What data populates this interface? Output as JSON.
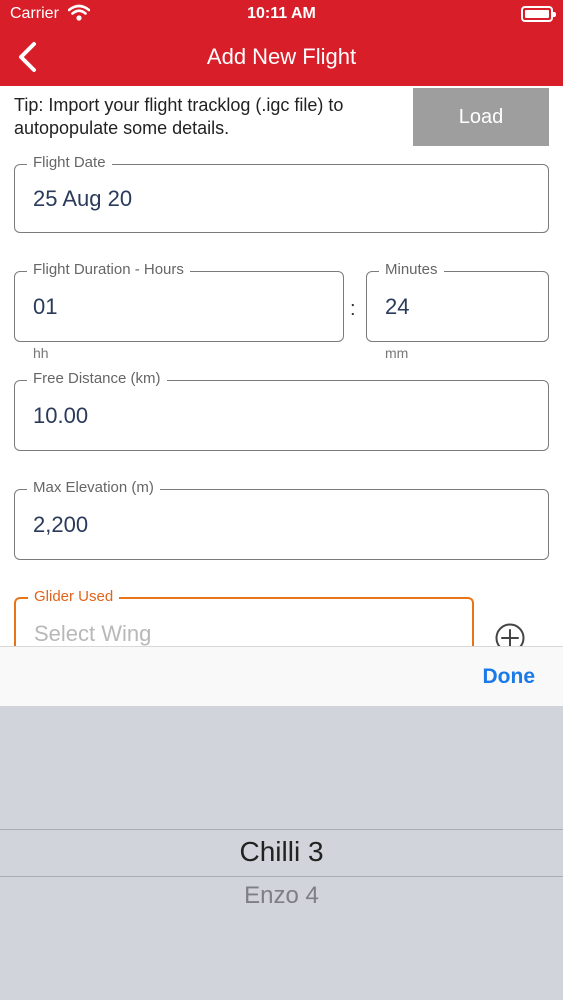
{
  "status": {
    "carrier": "Carrier",
    "time": "10:11 AM"
  },
  "nav": {
    "title": "Add New Flight"
  },
  "tip": {
    "text": "Tip: Import your flight tracklog (.igc file) to autopopulate some details.",
    "load_label": "Load"
  },
  "form": {
    "flight_date": {
      "label": "Flight Date",
      "value": "25 Aug 20"
    },
    "duration_hours": {
      "label": "Flight Duration - Hours",
      "value": "01",
      "helper": "hh"
    },
    "duration_minutes": {
      "label": "Minutes",
      "value": "24",
      "helper": "mm"
    },
    "separator": ":",
    "free_distance": {
      "label": "Free Distance (km)",
      "value": "10.00"
    },
    "max_elevation": {
      "label": "Max Elevation (m)",
      "value": "2,200"
    },
    "glider": {
      "label": "Glider Used",
      "placeholder": "Select Wing"
    }
  },
  "toolbar": {
    "done_label": "Done"
  },
  "picker": {
    "options": [
      "Chilli 3",
      "Enzo 4"
    ]
  },
  "colors": {
    "brand": "#d81e29",
    "focus": "#e8751a",
    "link": "#1a7ae8"
  }
}
